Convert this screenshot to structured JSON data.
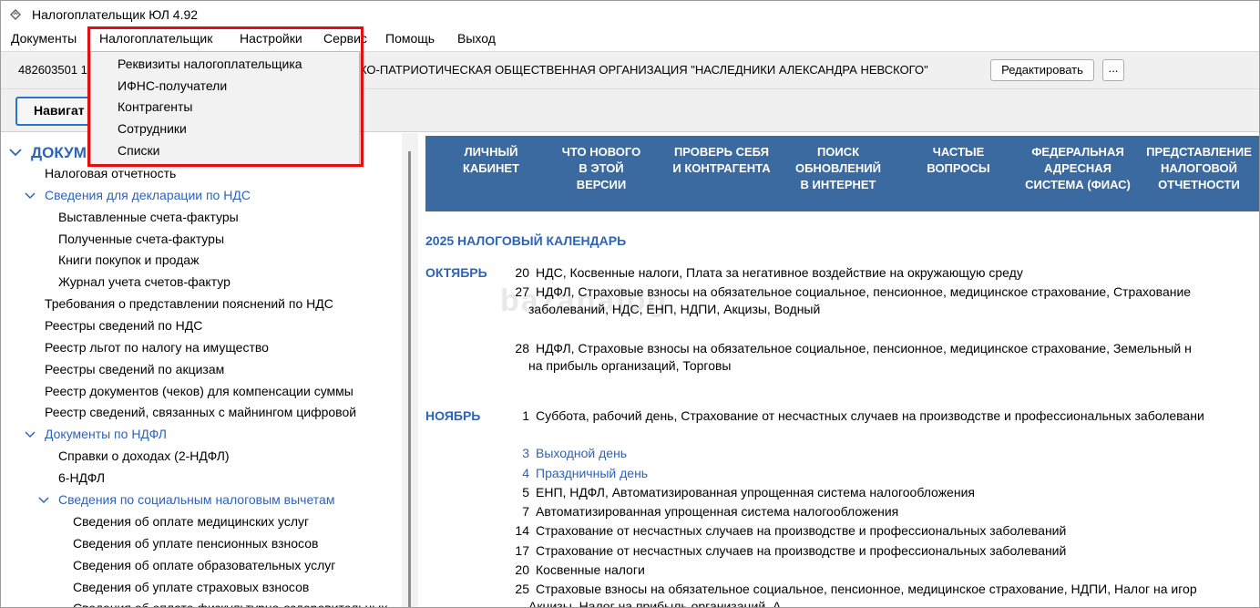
{
  "window": {
    "title": "Налогоплательщик ЮЛ 4.92"
  },
  "menu": [
    {
      "label": "Документы"
    },
    {
      "label": "Налогоплательщик"
    },
    {
      "label": "Настройки"
    },
    {
      "label": "Сервис"
    },
    {
      "label": "Помощь"
    },
    {
      "label": "Выход"
    }
  ],
  "taxpayer": {
    "inn": "482603501 1",
    "org_name": "КО-ПАТРИОТИЧЕСКАЯ ОБЩЕСТВЕННАЯ ОРГАНИЗАЦИЯ \"НАСЛЕДНИКИ АЛЕКСАНДРА НЕВСКОГО\"",
    "edit_label": "Редактировать",
    "more_label": "..."
  },
  "nav_button_label": "Навигат",
  "dropdown": [
    {
      "label": "Реквизиты налогоплательщика"
    },
    {
      "label": "ИФНС-получатели"
    },
    {
      "label": "Контрагенты"
    },
    {
      "label": "Сотрудники"
    },
    {
      "label": "Списки"
    }
  ],
  "tree": {
    "root": "ДОКУМ",
    "items": [
      {
        "label": "Налоговая отчетность"
      },
      {
        "label": "Сведения для декларации по НДС"
      },
      {
        "label": "Выставленные счета-фактуры"
      },
      {
        "label": "Полученные счета-фактуры"
      },
      {
        "label": "Книги покупок и продаж"
      },
      {
        "label": "Журнал учета счетов-фактур"
      },
      {
        "label": "Требования о представлении пояснений по НДС"
      },
      {
        "label": "Реестры сведений по НДС"
      },
      {
        "label": "Реестр льгот по налогу на имущество"
      },
      {
        "label": "Реестры сведений по акцизам"
      },
      {
        "label": "Реестр документов (чеков) для компенсации суммы"
      },
      {
        "label": "Реестр сведений, связанных с майнингом цифровой"
      },
      {
        "label": "Документы по НДФЛ"
      },
      {
        "label": "Справки о доходах (2-НДФЛ)"
      },
      {
        "label": "6-НДФЛ"
      },
      {
        "label": "Сведения по социальным налоговым вычетам"
      },
      {
        "label": "Сведения об оплате медицинских услуг"
      },
      {
        "label": "Сведения об уплате пенсионных взносов"
      },
      {
        "label": "Сведения об оплате образовательных услуг"
      },
      {
        "label": "Сведения об уплате страховых взносов"
      },
      {
        "label": "Сведения об оплате физкультурно-оздоровительных"
      }
    ]
  },
  "banner": [
    {
      "label": "ЛИЧНЫЙ\nКАБИНЕТ"
    },
    {
      "label": "ЧТО НОВОГО\nВ ЭТОЙ\nВЕРСИИ"
    },
    {
      "label": "ПРОВЕРЬ СЕБЯ\nИ КОНТРАГЕНТА"
    },
    {
      "label": "ПОИСК\nОБНОВЛЕНИЙ\nВ ИНТЕРНЕТ"
    },
    {
      "label": "ЧАСТЫЕ\nВОПРОСЫ"
    },
    {
      "label": "ФЕДЕРАЛЬНАЯ\nАДРЕСНАЯ\nСИСТЕМА (ФИАС)"
    },
    {
      "label": "ПРЕДСТАВЛЕНИЕ\nНАЛОГОВОЙ\nОТЧЕТНОСТИ"
    }
  ],
  "calendar": {
    "title": "2025  НАЛОГОВЫЙ КАЛЕНДАРЬ",
    "watermark": "bazanalog",
    "months": [
      {
        "name": "ОКТЯБРЬ",
        "events": [
          {
            "day": "20",
            "text": "НДС, Косвенные налоги, Плата за негативное воздействие на окружающую среду"
          },
          {
            "day": "27",
            "text": "НДФЛ, Страховые взносы на обязательное социальное, пенсионное, медицинское страхование, Страхование",
            "cont": "заболеваний, НДС, ЕНП, НДПИ, Акцизы, Водный"
          },
          {
            "day": "28",
            "text": "НДФЛ, Страховые взносы на обязательное социальное, пенсионное, медицинское страхование, Земельный н",
            "cont": "на прибыль организаций, Торговы"
          }
        ]
      },
      {
        "name": "НОЯБРЬ",
        "events": [
          {
            "day": "1",
            "text": "Суббота, рабочий день, Страхование от несчастных случаев на производстве и профессиональных заболевани"
          },
          {
            "day": "3",
            "text": "Выходной день"
          },
          {
            "day": "4",
            "text": "Праздничный день"
          },
          {
            "day": "5",
            "text": "ЕНП, НДФЛ, Автоматизированная упрощенная система налогообложения"
          },
          {
            "day": "7",
            "text": "Автоматизированная упрощенная система налогообложения"
          },
          {
            "day": "14",
            "text": "Страхование от несчастных случаев на производстве и профессиональных заболеваний"
          },
          {
            "day": "17",
            "text": "Страхование от несчастных случаев на производстве и профессиональных заболеваний"
          },
          {
            "day": "20",
            "text": "Косвенные налоги"
          },
          {
            "day": "25",
            "text": "Страховые взносы на обязательное социальное, пенсионное, медицинское страхование, НДПИ, Налог на игор",
            "cont": "Акцизы, Налог на прибыль организаций, А"
          }
        ]
      }
    ]
  },
  "colors": {
    "banner": "#3a6aa0",
    "link": "#2e63b8",
    "highlight": "#e01010"
  }
}
